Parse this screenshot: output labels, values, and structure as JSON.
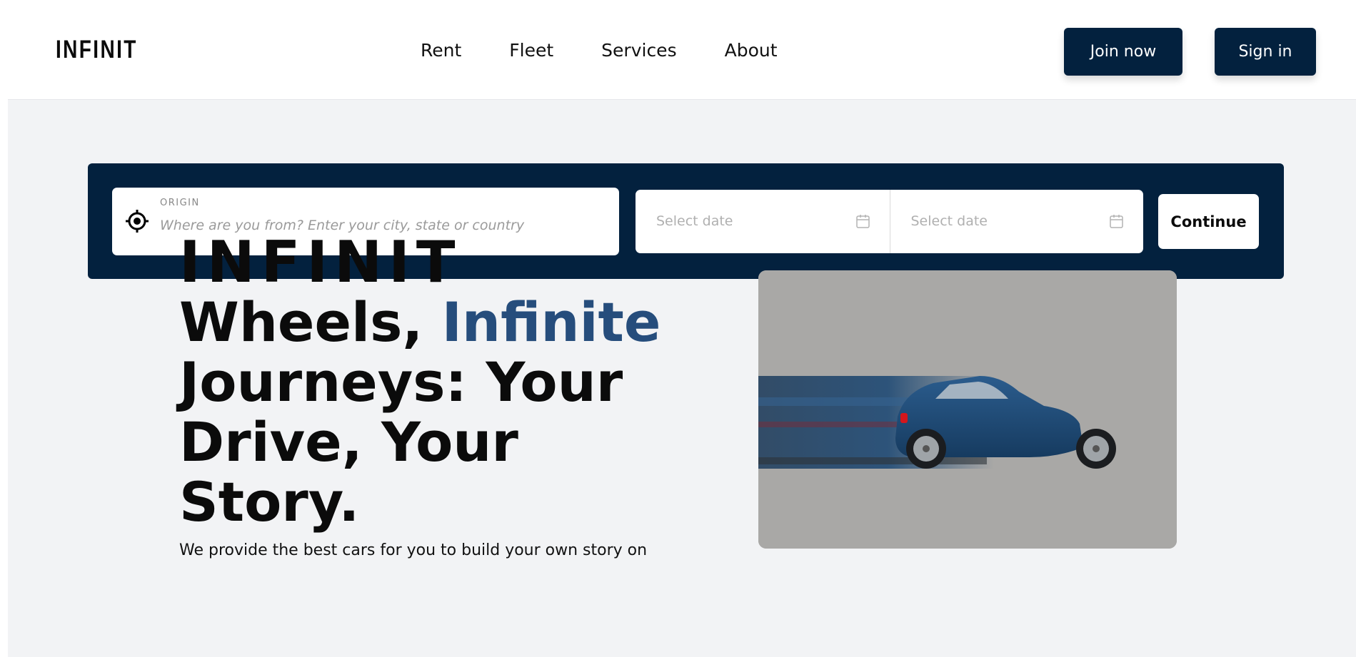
{
  "header": {
    "logo": "INFINIT",
    "nav": [
      "Rent",
      "Fleet",
      "Services",
      "About"
    ],
    "join_label": "Join now",
    "signin_label": "Sign in"
  },
  "search": {
    "origin_label": "ORIGIN",
    "origin_placeholder": "Where are you from? Enter your city, state or country",
    "start_date_placeholder": "Select date",
    "end_date_placeholder": "Select date",
    "continue_label": "Continue"
  },
  "hero": {
    "brand": "INFINIT",
    "headline_part1": "Wheels, ",
    "headline_accent": "Infinite",
    "headline_part2": "Journeys: Your Drive, Your Story.",
    "lead": "We provide the best cars for you to build your own story on"
  },
  "colors": {
    "navy": "#03213e",
    "accent": "#264d7c",
    "background": "#f2f3f5"
  },
  "icons": {
    "origin": "crosshair-target-icon",
    "date": "calendar-icon"
  }
}
